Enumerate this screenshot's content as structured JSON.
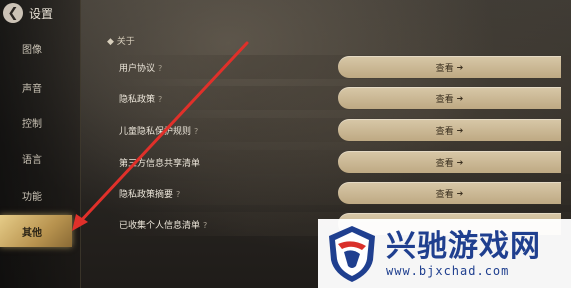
{
  "header": {
    "back_icon": "back-arrow-icon",
    "title": "设置"
  },
  "sidebar": {
    "items": [
      {
        "label": "图像",
        "active": false
      },
      {
        "label": "声音",
        "active": false
      },
      {
        "label": "控制",
        "active": false
      },
      {
        "label": "语言",
        "active": false
      },
      {
        "label": "功能",
        "active": false
      },
      {
        "label": "其他",
        "active": true
      }
    ]
  },
  "section": {
    "label": "◆ 关于"
  },
  "rows": [
    {
      "label": "用户协议",
      "has_help": true,
      "button": "查看"
    },
    {
      "label": "隐私政策",
      "has_help": true,
      "button": "查看"
    },
    {
      "label": "儿童隐私保护规则",
      "has_help": true,
      "button": "查看"
    },
    {
      "label": "第三方信息共享清单",
      "has_help": false,
      "button": "查看"
    },
    {
      "label": "隐私政策摘要",
      "has_help": true,
      "button": "查看"
    },
    {
      "label": "已收集个人信息清单",
      "has_help": true,
      "button": ""
    }
  ],
  "help_mark": "?",
  "button_arrow": "➔",
  "colors": {
    "accent": "#c9a865",
    "annotation": "#e0302a",
    "watermark_blue": "#1f3f8f"
  },
  "watermark": {
    "title": "兴驰游戏网",
    "url": "www.bjxchad.com"
  }
}
